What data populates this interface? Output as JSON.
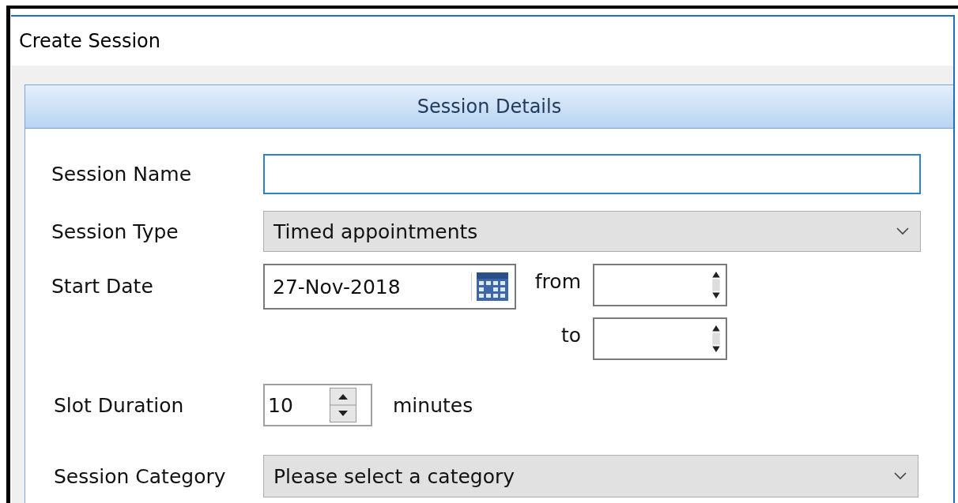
{
  "window": {
    "title": "Create Session"
  },
  "panel": {
    "title": "Session Details"
  },
  "session_name": {
    "label": "Session Name",
    "focused": true
  },
  "session_type": {
    "label": "Session Type",
    "value": "Timed appointments"
  },
  "start_date": {
    "label": "Start Date",
    "value": "27-Nov-2018"
  },
  "time_from": {
    "label": "from"
  },
  "time_to": {
    "label": "to"
  },
  "slot_duration": {
    "label": "Slot Duration",
    "value": "10",
    "unit": "minutes"
  },
  "session_category": {
    "label": "Session Category",
    "placeholder": "Please select a category"
  }
}
